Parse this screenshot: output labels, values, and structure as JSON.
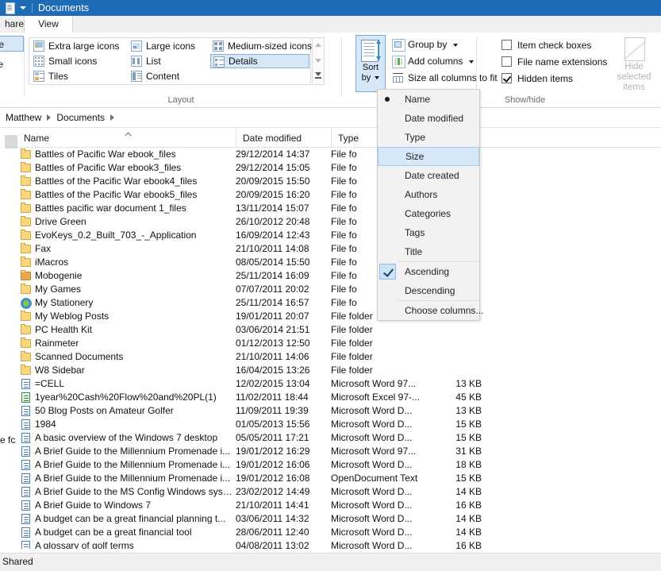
{
  "window": {
    "title": "Documents",
    "icon": "document-folder-icon",
    "quick_access_caret": "chevron-down-icon"
  },
  "tabs": [
    {
      "label": "hare",
      "full_label": "Share",
      "active": false
    },
    {
      "label": "View",
      "active": true
    }
  ],
  "ribbon": {
    "panes_group": {
      "items": [
        {
          "label": "ane",
          "full_label": "Navigation pane",
          "selected": true
        },
        {
          "label": "ane",
          "full_label": "Preview pane",
          "selected": false
        }
      ]
    },
    "layout_group": {
      "label": "Layout",
      "options": [
        {
          "label": "Extra large icons",
          "icon": "extra-large-icons-icon",
          "selected": false
        },
        {
          "label": "Large icons",
          "icon": "large-icons-icon",
          "selected": false
        },
        {
          "label": "Medium-sized icons",
          "icon": "medium-icons-icon",
          "selected": false
        },
        {
          "label": "Small icons",
          "icon": "small-icons-icon",
          "selected": false
        },
        {
          "label": "List",
          "icon": "list-view-icon",
          "selected": false
        },
        {
          "label": "Details",
          "icon": "details-view-icon",
          "selected": true
        },
        {
          "label": "Tiles",
          "icon": "tiles-view-icon",
          "selected": false
        },
        {
          "label": "Content",
          "icon": "content-view-icon",
          "selected": false
        }
      ]
    },
    "current_view_group": {
      "sort_by": {
        "line1": "Sort",
        "line2": "by",
        "icon": "sort-by-icon",
        "active": true
      },
      "items": [
        {
          "label": "Group by",
          "icon": "group-by-icon",
          "has_caret": true
        },
        {
          "label": "Add columns",
          "icon": "add-columns-icon",
          "has_caret": true
        },
        {
          "label": "Size all columns to fit",
          "icon": "size-columns-icon",
          "has_caret": false
        }
      ]
    },
    "show_hide_group": {
      "label": "Show/hide",
      "checkboxes": [
        {
          "label": "Item check boxes",
          "checked": false
        },
        {
          "label": "File name extensions",
          "checked": false
        },
        {
          "label": "Hidden items",
          "checked": true
        }
      ],
      "hide_selected": {
        "line1": "Hide selected",
        "line2": "items",
        "icon": "hide-items-icon",
        "disabled": true
      }
    }
  },
  "sort_menu": {
    "columns": [
      {
        "label": "Name",
        "marker": "bullet",
        "highlighted": false
      },
      {
        "label": "Date modified",
        "marker": "none",
        "highlighted": false
      },
      {
        "label": "Type",
        "marker": "none",
        "highlighted": false
      },
      {
        "label": "Size",
        "marker": "none",
        "highlighted": true
      },
      {
        "label": "Date created",
        "marker": "none",
        "highlighted": false
      },
      {
        "label": "Authors",
        "marker": "none",
        "highlighted": false
      },
      {
        "label": "Categories",
        "marker": "none",
        "highlighted": false
      },
      {
        "label": "Tags",
        "marker": "none",
        "highlighted": false
      },
      {
        "label": "Title",
        "marker": "none",
        "highlighted": false
      }
    ],
    "directions": [
      {
        "label": "Ascending",
        "marker": "check",
        "highlighted": false
      },
      {
        "label": "Descending",
        "marker": "none",
        "highlighted": false
      }
    ],
    "extra": [
      {
        "label": "Choose columns...",
        "marker": "none",
        "highlighted": false
      }
    ]
  },
  "address_bar": {
    "crumbs": [
      "Matthew",
      "Documents"
    ]
  },
  "columns": [
    {
      "label": "Name",
      "sorted": true
    },
    {
      "label": "Date modified",
      "sorted": false
    },
    {
      "label": "Type",
      "sorted": false
    },
    {
      "label": "Size",
      "sorted": false
    }
  ],
  "files": [
    {
      "name": "Battles of Pacific War ebook_files",
      "date": "29/12/2014 14:37",
      "type": "File fo",
      "size": "",
      "icon": "folder-icon"
    },
    {
      "name": "Battles of Pacific War ebook3_files",
      "date": "29/12/2014 15:05",
      "type": "File fo",
      "size": "",
      "icon": "folder-icon"
    },
    {
      "name": "Battles of the Pacific War ebook4_files",
      "date": "20/09/2015 15:50",
      "type": "File fo",
      "size": "",
      "icon": "folder-icon"
    },
    {
      "name": "Battles of the Pacific War ebook5_files",
      "date": "20/09/2015 16:20",
      "type": "File fo",
      "size": "",
      "icon": "folder-icon"
    },
    {
      "name": "Battles pacific war document 1_files",
      "date": "13/11/2014 15:07",
      "type": "File fo",
      "size": "",
      "icon": "folder-icon"
    },
    {
      "name": "Drive Green",
      "date": "26/10/2012 20:48",
      "type": "File fo",
      "size": "",
      "icon": "folder-icon"
    },
    {
      "name": "EvoKeys_0.2_Built_703_-_Application",
      "date": "16/09/2014 12:43",
      "type": "File fo",
      "size": "",
      "icon": "folder-icon"
    },
    {
      "name": "Fax",
      "date": "21/10/2011 14:08",
      "type": "File fo",
      "size": "",
      "icon": "folder-icon"
    },
    {
      "name": "iMacros",
      "date": "08/05/2014 15:50",
      "type": "File fo",
      "size": "",
      "icon": "folder-icon"
    },
    {
      "name": "Mobogenie",
      "date": "25/11/2014 16:09",
      "type": "File fo",
      "size": "",
      "icon": "folder-open-icon"
    },
    {
      "name": "My Games",
      "date": "07/07/2011 20:02",
      "type": "File fo",
      "size": "",
      "icon": "folder-icon"
    },
    {
      "name": "My Stationery",
      "date": "25/11/2014 16:57",
      "type": "File fo",
      "size": "",
      "icon": "stationery-folder-icon"
    },
    {
      "name": "My Weblog Posts",
      "date": "19/01/2011 20:07",
      "type": "File folder",
      "size": "",
      "icon": "folder-icon"
    },
    {
      "name": "PC Health Kit",
      "date": "03/06/2014 21:51",
      "type": "File folder",
      "size": "",
      "icon": "folder-icon"
    },
    {
      "name": "Rainmeter",
      "date": "01/12/2013 12:50",
      "type": "File folder",
      "size": "",
      "icon": "folder-icon"
    },
    {
      "name": "Scanned Documents",
      "date": "21/10/2011 14:06",
      "type": "File folder",
      "size": "",
      "icon": "folder-icon"
    },
    {
      "name": "W8 Sidebar",
      "date": "16/04/2015 13:26",
      "type": "File folder",
      "size": "",
      "icon": "folder-icon"
    },
    {
      "name": "=CELL",
      "date": "12/02/2015 13:04",
      "type": "Microsoft Word 97...",
      "size": "13 KB",
      "icon": "word-document-icon"
    },
    {
      "name": "1year%20Cash%20Flow%20and%20PL(1)",
      "date": "11/02/2011 18:44",
      "type": "Microsoft Excel 97-...",
      "size": "45 KB",
      "icon": "excel-document-icon"
    },
    {
      "name": "50 Blog Posts on Amateur Golfer",
      "date": "11/09/2011 19:39",
      "type": "Microsoft Word D...",
      "size": "13 KB",
      "icon": "word-document-icon"
    },
    {
      "name": "1984",
      "date": "01/05/2013 15:56",
      "type": "Microsoft Word D...",
      "size": "15 KB",
      "icon": "word-document-icon"
    },
    {
      "name": "A basic overview of the Windows 7 desktop",
      "date": "05/05/2011 17:21",
      "type": "Microsoft Word D...",
      "size": "15 KB",
      "icon": "word-document-icon"
    },
    {
      "name": "A Brief Guide to the Millennium Promenade i...",
      "date": "19/01/2012 16:29",
      "type": "Microsoft Word 97...",
      "size": "31 KB",
      "icon": "word-document-icon"
    },
    {
      "name": "A Brief Guide to the Millennium Promenade i...",
      "date": "19/01/2012 16:06",
      "type": "Microsoft Word D...",
      "size": "18 KB",
      "icon": "word-document-icon"
    },
    {
      "name": "A Brief Guide to the Millennium Promenade i...",
      "date": "19/01/2012 16:08",
      "type": "OpenDocument Text",
      "size": "15 KB",
      "icon": "word-document-icon"
    },
    {
      "name": "A Brief Guide to the MS Config Windows syst...",
      "date": "23/02/2012 14:49",
      "type": "Microsoft Word D...",
      "size": "14 KB",
      "icon": "word-document-icon"
    },
    {
      "name": "A Brief Guide to Windows 7",
      "date": "21/10/2011 14:41",
      "type": "Microsoft Word D...",
      "size": "16 KB",
      "icon": "word-document-icon"
    },
    {
      "name": "A budget can be a great financial planning t...",
      "date": "03/06/2011 14:32",
      "type": "Microsoft Word D...",
      "size": "14 KB",
      "icon": "word-document-icon"
    },
    {
      "name": "A budget can be a great financial tool",
      "date": "28/06/2011 12:40",
      "type": "Microsoft Word D...",
      "size": "14 KB",
      "icon": "word-document-icon"
    },
    {
      "name": "A glossary of golf terms",
      "date": "04/08/2011 13:02",
      "type": "Microsoft Word D...",
      "size": "16 KB",
      "icon": "word-document-icon"
    }
  ],
  "nav_pane": {
    "partial_text": "e fc"
  },
  "status_bar": {
    "text": "Shared"
  }
}
